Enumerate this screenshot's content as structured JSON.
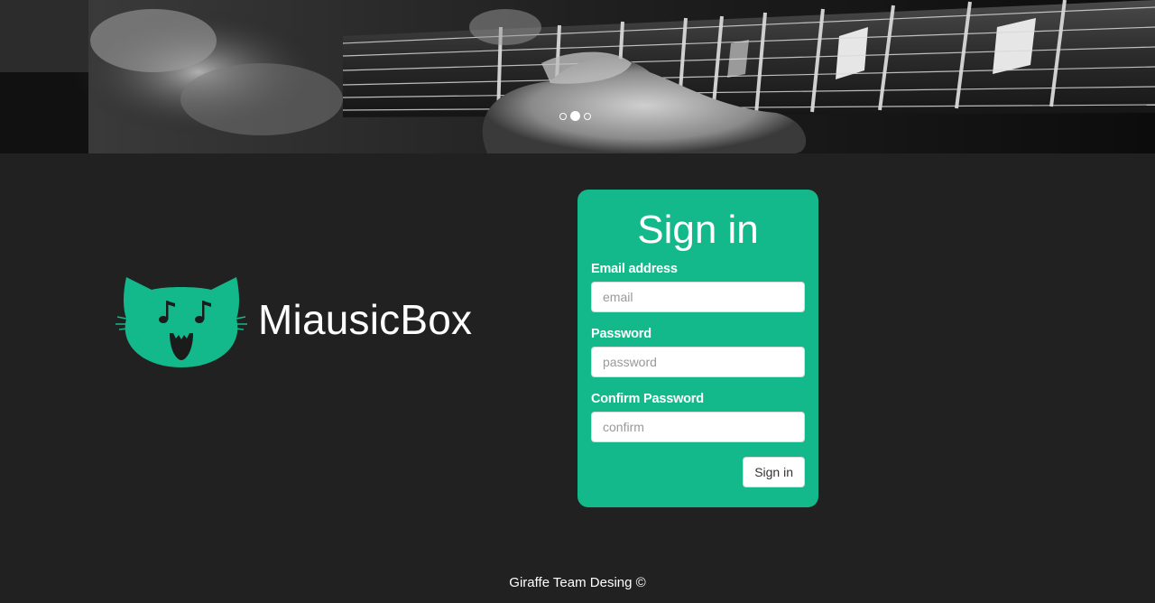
{
  "carousel": {
    "slide_count": 3,
    "active_slide": 2
  },
  "brand": {
    "name": "MiausicBox",
    "accent_color": "#14b98b"
  },
  "signin": {
    "title": "Sign in",
    "email_label": "Email address",
    "email_placeholder": "email",
    "password_label": "Password",
    "password_placeholder": "password",
    "confirm_label": "Confirm Password",
    "confirm_placeholder": "confirm",
    "submit_label": "Sign in"
  },
  "footer": {
    "text": "Giraffe Team Desing ©"
  },
  "colors": {
    "background": "#212121",
    "card": "#14b98b",
    "text": "#ffffff"
  }
}
